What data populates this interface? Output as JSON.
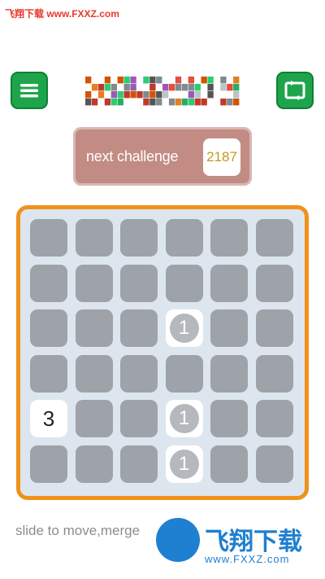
{
  "watermark": {
    "top_text": "飞翔下载 www.FXXZ.com",
    "brand": "飞翔下载",
    "url": "www.FXXZ.com"
  },
  "header": {
    "menu_icon": "menu-icon",
    "restart_icon": "restart-icon",
    "colors": {
      "button": "#1ea54c"
    }
  },
  "next_challenge": {
    "label": "next challenge",
    "value": "2187"
  },
  "board": {
    "size": 6,
    "tiles": [
      {
        "row": 2,
        "col": 3,
        "value": "1",
        "style": "disc"
      },
      {
        "row": 4,
        "col": 0,
        "value": "3",
        "style": "plain"
      },
      {
        "row": 4,
        "col": 3,
        "value": "1",
        "style": "disc"
      },
      {
        "row": 5,
        "col": 3,
        "value": "1",
        "style": "disc"
      }
    ],
    "colors": {
      "border": "#f0911b",
      "cell": "#9ea3a9",
      "background": "#dde6ee"
    }
  },
  "hint": {
    "text": "slide to move,merge"
  }
}
